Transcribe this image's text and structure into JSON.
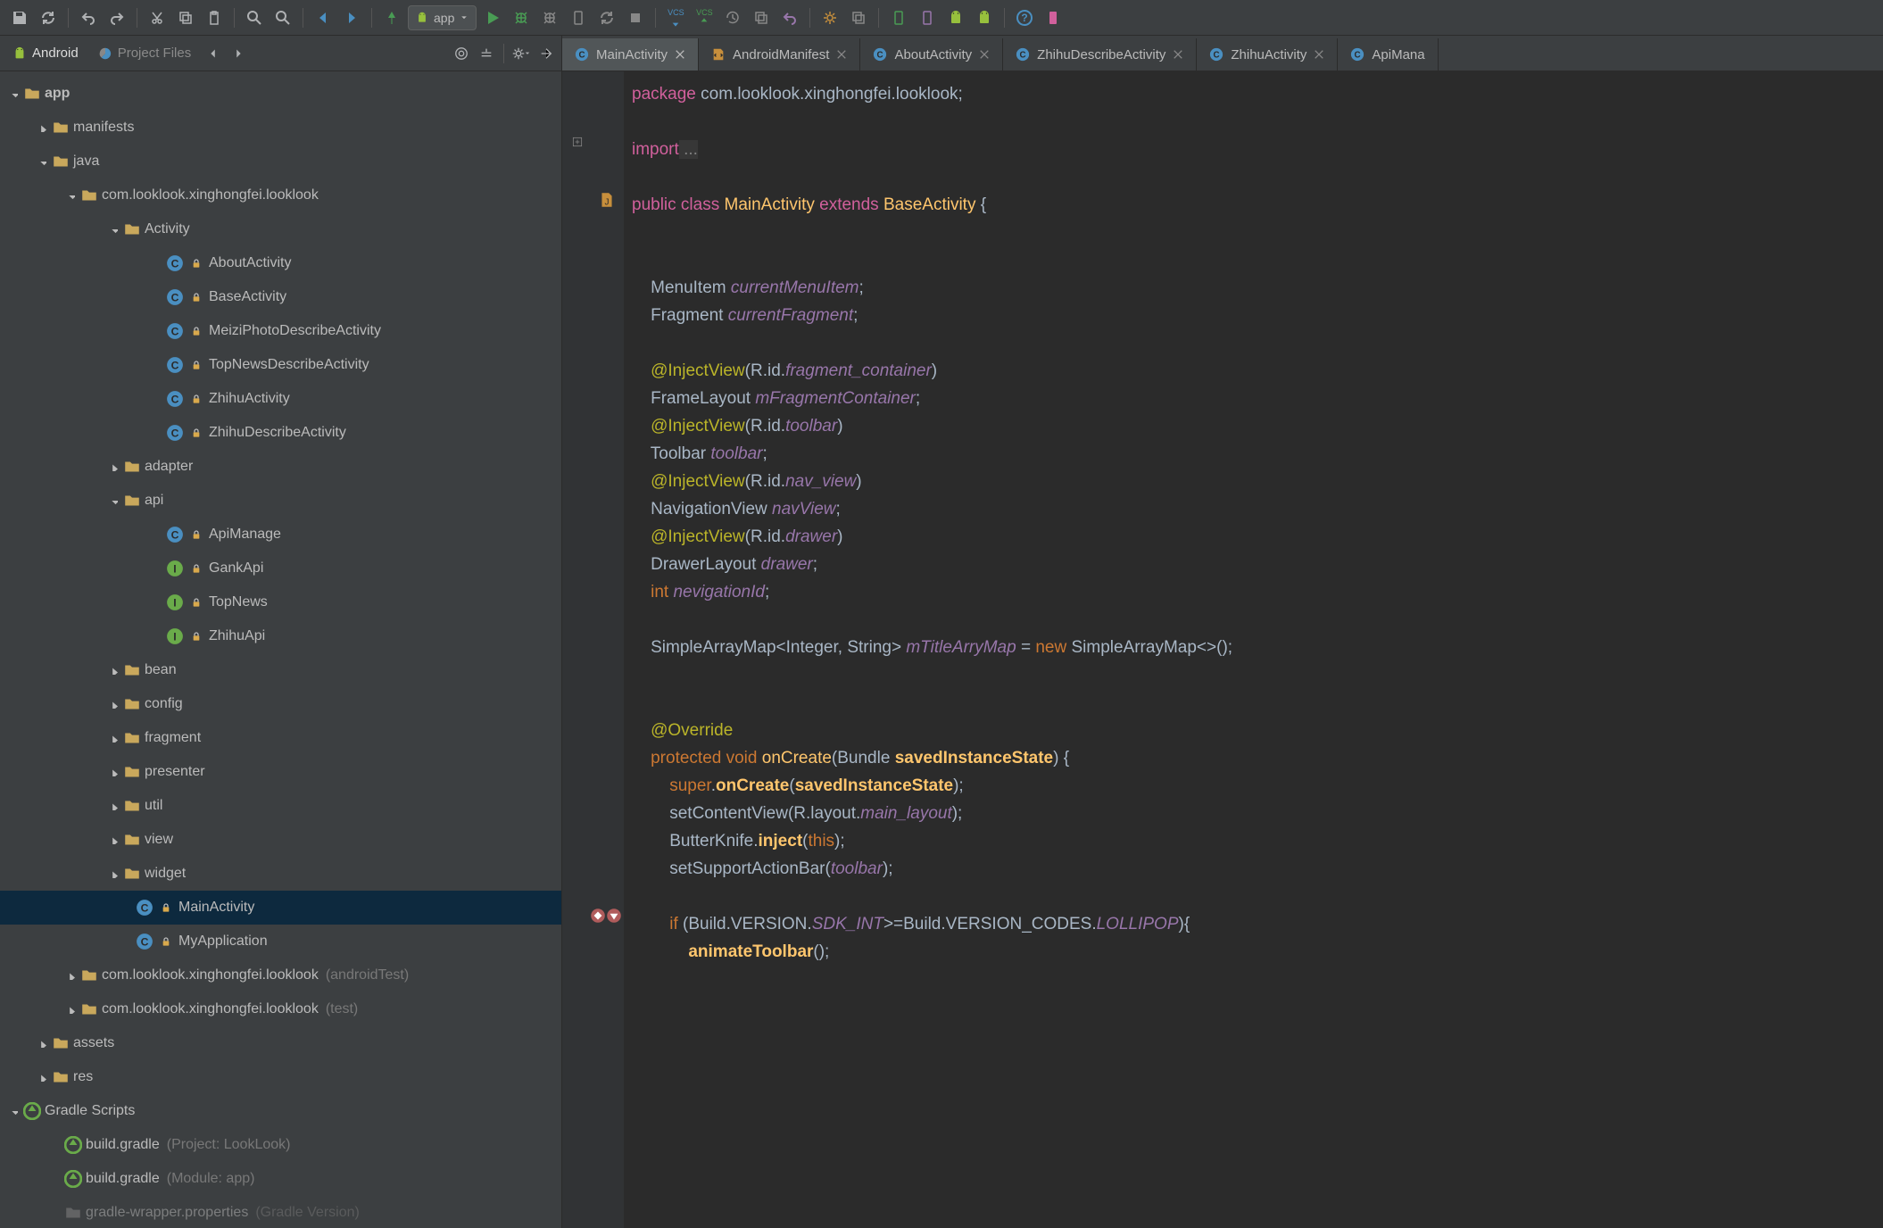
{
  "toolbar": {
    "run_config": "app"
  },
  "side_tabs": {
    "android": "Android",
    "project_files": "Project Files"
  },
  "tree": {
    "app": "app",
    "manifests": "manifests",
    "java": "java",
    "pkg_main": "com.looklook.xinghongfei.looklook",
    "activity": "Activity",
    "about": "AboutActivity",
    "base": "BaseActivity",
    "meizi": "MeiziPhotoDescribeActivity",
    "topnews": "TopNewsDescribeActivity",
    "zhihu": "ZhihuActivity",
    "zhihudesc": "ZhihuDescribeActivity",
    "adapter": "adapter",
    "api": "api",
    "apimanage": "ApiManage",
    "gankapi": "GankApi",
    "topnews_i": "TopNews",
    "zhihuapi": "ZhihuApi",
    "bean": "bean",
    "config": "config",
    "fragment": "fragment",
    "presenter": "presenter",
    "util": "util",
    "view": "view",
    "widget": "widget",
    "mainactivity": "MainActivity",
    "myapplication": "MyApplication",
    "pkg_android": "com.looklook.xinghongfei.looklook",
    "pkg_android_suffix": "(androidTest)",
    "pkg_test": "com.looklook.xinghongfei.looklook",
    "pkg_test_suffix": "(test)",
    "assets": "assets",
    "res": "res",
    "gradle_scripts": "Gradle Scripts",
    "build_gradle_p": "build.gradle",
    "build_gradle_p_suffix": "(Project: LookLook)",
    "build_gradle_m": "build.gradle",
    "build_gradle_m_suffix": "(Module: app)",
    "gradle_wrapper": "gradle-wrapper.properties",
    "gradle_wrapper_suffix": "(Gradle Version)"
  },
  "tabs": {
    "main": "MainActivity",
    "manifest": "AndroidManifest",
    "about": "AboutActivity",
    "zhihudesc": "ZhihuDescribeActivity",
    "zhihu": "ZhihuActivity",
    "apimana": "ApiMana"
  },
  "code": {
    "l1a": "package",
    "l1b": " com",
    "l1c": ".",
    "l1d": "looklook",
    "l1e": ".",
    "l1f": "xinghongfei",
    "l1g": ".",
    "l1h": "looklook",
    "l1i": ";",
    "l3a": "import",
    "l3b": " ...",
    "l5a": "public class",
    "l5b": " MainActivity ",
    "l5c": "extends",
    "l5d": " BaseActivity ",
    "l5e": "{",
    "l8a": "    MenuItem ",
    "l8b": "currentMenuItem",
    "l8c": ";",
    "l9a": "    Fragment ",
    "l9b": "currentFragment",
    "l9c": ";",
    "l11a": "    @InjectView",
    "l11b": "(R",
    "l11c": ".",
    "l11d": "id",
    "l11e": ".",
    "l11f": "fragment_container",
    "l11g": ")",
    "l12a": "    FrameLayout ",
    "l12b": "mFragmentContainer",
    "l12c": ";",
    "l13a": "    @InjectView",
    "l13b": "(R",
    "l13c": ".",
    "l13d": "id",
    "l13e": ".",
    "l13f": "toolbar",
    "l13g": ")",
    "l14a": "    Toolbar ",
    "l14b": "toolbar",
    "l14c": ";",
    "l15a": "    @InjectView",
    "l15b": "(R",
    "l15c": ".",
    "l15d": "id",
    "l15e": ".",
    "l15f": "nav_view",
    "l15g": ")",
    "l16a": "    NavigationView ",
    "l16b": "navView",
    "l16c": ";",
    "l17a": "    @InjectView",
    "l17b": "(R",
    "l17c": ".",
    "l17d": "id",
    "l17e": ".",
    "l17f": "drawer",
    "l17g": ")",
    "l18a": "    DrawerLayout ",
    "l18b": "drawer",
    "l18c": ";",
    "l19a": "    int",
    "l19b": " nevigationId",
    "l19c": ";",
    "l21a": "    SimpleArrayMap",
    "l21b": "<",
    "l21c": "Integer",
    "l21d": ", ",
    "l21e": "String",
    "l21f": "> ",
    "l21g": "mTitleArryMap",
    "l21h": " = ",
    "l21i": "new",
    "l21j": " SimpleArrayMap",
    "l21k": "<>();",
    "l24a": "    @Override",
    "l25a": "    protected void",
    "l25b": " onCreate",
    "l25c": "(",
    "l25d": "Bundle ",
    "l25e": "savedInstanceState",
    "l25f": ") {",
    "l26a": "        super",
    "l26b": ".",
    "l26c": "onCreate",
    "l26d": "(",
    "l26e": "savedInstanceState",
    "l26f": ");",
    "l27a": "        setContentView(R",
    "l27b": ".",
    "l27c": "layout",
    "l27d": ".",
    "l27e": "main_layout",
    "l27f": ");",
    "l28a": "        ButterKnife",
    "l28b": ".",
    "l28c": "inject",
    "l28d": "(",
    "l28e": "this",
    "l28f": ");",
    "l29a": "        setSupportActionBar(",
    "l29b": "toolbar",
    "l29c": ");",
    "l31a": "        if",
    "l31b": " (Build",
    "l31c": ".",
    "l31d": "VERSION",
    "l31e": ".",
    "l31f": "SDK_INT",
    "l31g": ">=Build",
    "l31h": ".",
    "l31i": "VERSION_CODES",
    "l31j": ".",
    "l31k": "LOLLIPOP",
    "l31l": "){",
    "l32a": "            animateToolbar",
    "l32b": "();"
  }
}
